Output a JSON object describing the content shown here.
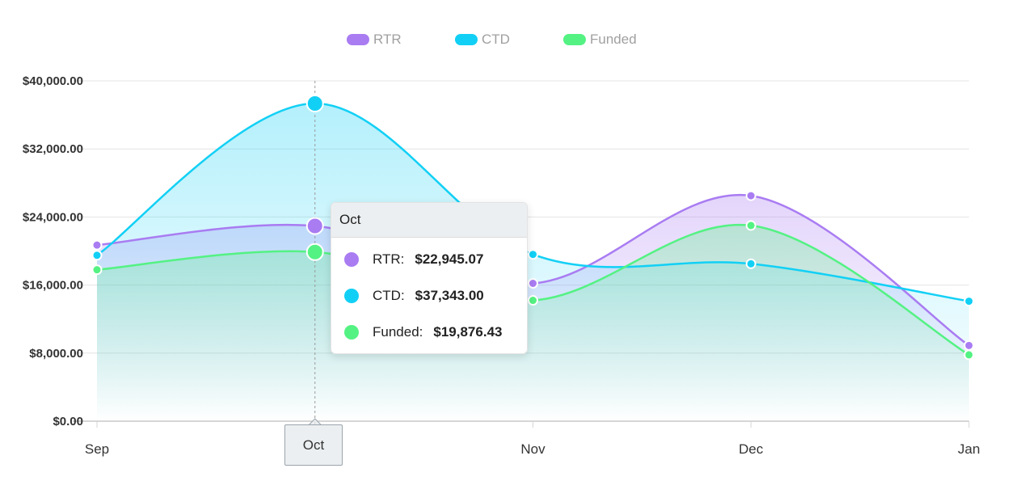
{
  "chart_data": {
    "type": "area",
    "categories": [
      "Sep",
      "Oct",
      "Nov",
      "Dec",
      "Jan"
    ],
    "ylim": [
      0,
      40000
    ],
    "yticks": [
      {
        "value": 0,
        "label": "$0.00"
      },
      {
        "value": 8000,
        "label": "$8,000.00"
      },
      {
        "value": 16000,
        "label": "$16,000.00"
      },
      {
        "value": 24000,
        "label": "$24,000.00"
      },
      {
        "value": 32000,
        "label": "$32,000.00"
      },
      {
        "value": 40000,
        "label": "$40,000.00"
      }
    ],
    "grid": true,
    "legend_position": "top-center",
    "series": [
      {
        "name": "RTR",
        "color": "#a97cf2",
        "values": [
          20700,
          22945.07,
          16200,
          26500,
          8900
        ]
      },
      {
        "name": "CTD",
        "color": "#12d0f5",
        "values": [
          19500,
          37343.0,
          19600,
          18500,
          14100
        ]
      },
      {
        "name": "Funded",
        "color": "#54f283",
        "values": [
          17800,
          19876.43,
          14200,
          23000,
          7800
        ]
      }
    ],
    "tooltip": {
      "title": "Oct",
      "rows": [
        {
          "label": "RTR:",
          "value": "$22,945.07",
          "color": "#a97cf2"
        },
        {
          "label": "CTD:",
          "value": "$37,343.00",
          "color": "#12d0f5"
        },
        {
          "label": "Funded:",
          "value": "$19,876.43",
          "color": "#54f283"
        }
      ]
    },
    "crosshair_label": "Oct"
  }
}
